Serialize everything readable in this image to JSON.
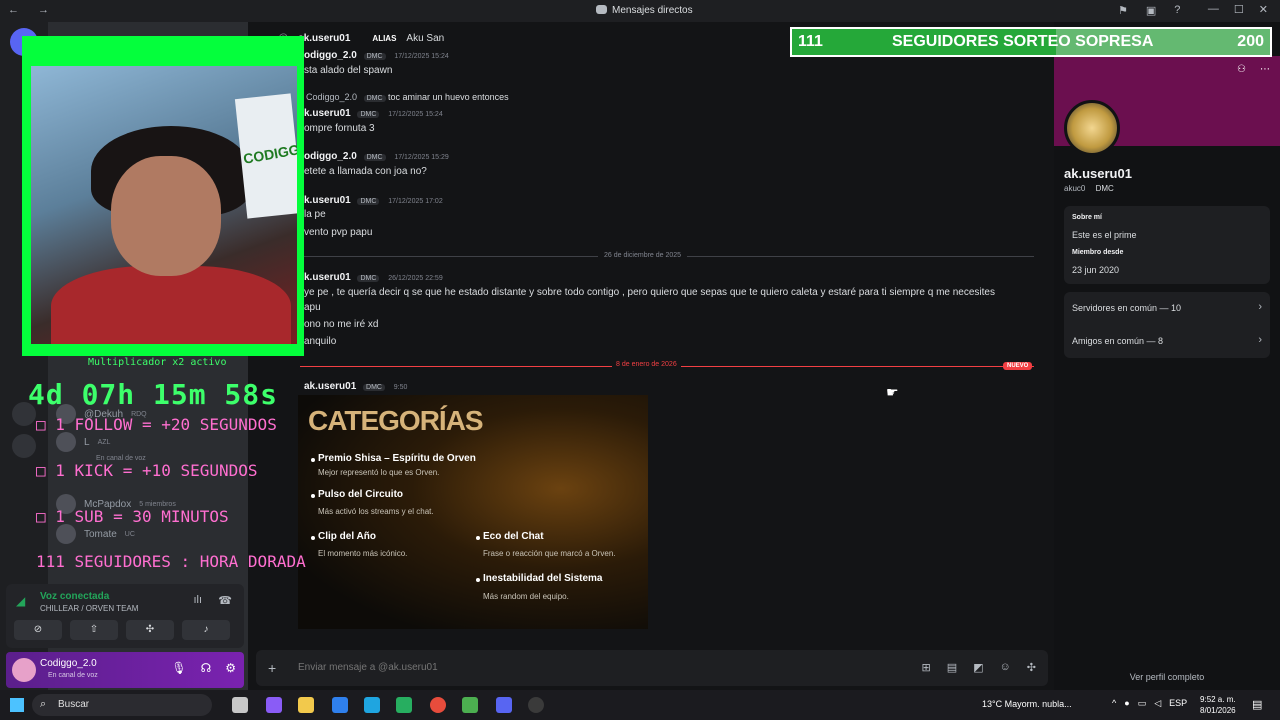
{
  "titlebar": {
    "title": "Mensajes directos",
    "nav": "← →"
  },
  "header": {
    "username": "ak.useru01",
    "alias_label": "ALIAS",
    "alias_value": "Aku San"
  },
  "messages": [
    {
      "author": "odiggo_2.0",
      "tag": "DMC",
      "ts": "17/12/2025 15:24",
      "lines": [
        "sta alado del spawn"
      ]
    },
    {
      "reply": "Codiggo_2.0",
      "reply_tag": "DMC",
      "reply_text": "toc aminar un huevo entonces"
    },
    {
      "author": "k.useru01",
      "tag": "DMC",
      "ts": "17/12/2025 15:24",
      "lines": [
        "ompre fornuta 3"
      ]
    },
    {
      "author": "odiggo_2.0",
      "tag": "DMC",
      "ts": "17/12/2025 15:29",
      "lines": [
        "etete a llamada con joa no?"
      ]
    },
    {
      "author": "k.useru01",
      "tag": "DMC",
      "ts": "17/12/2025 17:02",
      "lines": [
        "la pe",
        "vento pvp papu"
      ]
    },
    {
      "author": "k.useru01",
      "tag": "DMC",
      "ts": "26/12/2025 22:59",
      "lines": [
        "ye pe , te quería decir q se que he estado distante y sobre todo contigo , pero quiero que sepas que te quiero caleta y estaré para ti siempre q me necesites",
        "apu",
        "ono no me iré xd",
        "anquilo"
      ]
    },
    {
      "author": "ak.useru01",
      "tag": "DMC",
      "ts": "9:50",
      "lines": []
    }
  ],
  "dividers": {
    "dec": "26 de diciembre de 2025",
    "jan": "8 de enero de 2026",
    "new": "NUEVO"
  },
  "embed": {
    "title": "CATEGORÍAS",
    "items": [
      {
        "name": "Premio Shisa – Espíritu de Orven",
        "desc": "Mejor representó lo que es Orven."
      },
      {
        "name": "Pulso del Circuito",
        "desc": "Más activó los streams y el chat."
      },
      {
        "name": "Clip del Año",
        "desc": "El momento más icónico."
      },
      {
        "name": "Eco del Chat",
        "desc": "Frase o reacción que marcó a Orven."
      },
      {
        "name": "Inestabilidad del Sistema",
        "desc": "Más random del equipo."
      }
    ]
  },
  "composer": {
    "placeholder": "Enviar mensaje a @ak.useru01"
  },
  "profile": {
    "name": "ak.useru01",
    "tag": "akuc0",
    "tag_badge": "DMC",
    "about_label": "Sobre mí",
    "about_value": "Este es el prime",
    "member_label": "Miembro desde",
    "member_value": "23 jun 2020",
    "servers": "Servidores en común — 10",
    "friends": "Amigos en común — 8",
    "full_profile": "Ver perfil completo"
  },
  "sidebar": {
    "dms": [
      {
        "name": "@Dekuh",
        "sub": "RDQ"
      },
      {
        "name": "L",
        "sub": "AZL"
      },
      {
        "name": "",
        "sub": "En canal de voz"
      },
      {
        "name": "McPapdox",
        "sub": "5 miembros"
      },
      {
        "name": "Tomate",
        "sub": "UC"
      }
    ]
  },
  "voice": {
    "title": "Voz conectada",
    "channel": "CHILLEAR / ORVEN TEAM"
  },
  "user": {
    "name": "Codiggo_2.0",
    "status": "En canal de voz"
  },
  "overlay": {
    "banner_left": "111",
    "banner_mid": "SEGUIDORES SORTEO SOPRESA",
    "banner_right": "200",
    "multiplier": "Multiplicador x2 activo",
    "timer": "4d 07h 15m 58s",
    "rules": [
      "□ 1 FOLLOW = +20 SEGUNDOS",
      "□ 1 KICK = +10 SEGUNDOS",
      "□ 1 SUB = 30 MINUTOS",
      "111 SEGUIDORES : HORA DORADA"
    ],
    "rule_colors": [
      "#ff6fd0",
      "#ff6fd0",
      "#ff6fd0",
      "#ff6fd0"
    ],
    "cam_poster": "CODIGG"
  },
  "taskbar": {
    "search": "Buscar",
    "weather": "13°C  Mayorm. nubla...",
    "lang": "ESP",
    "time": "9:52 a. m.",
    "date": "8/01/2026"
  }
}
